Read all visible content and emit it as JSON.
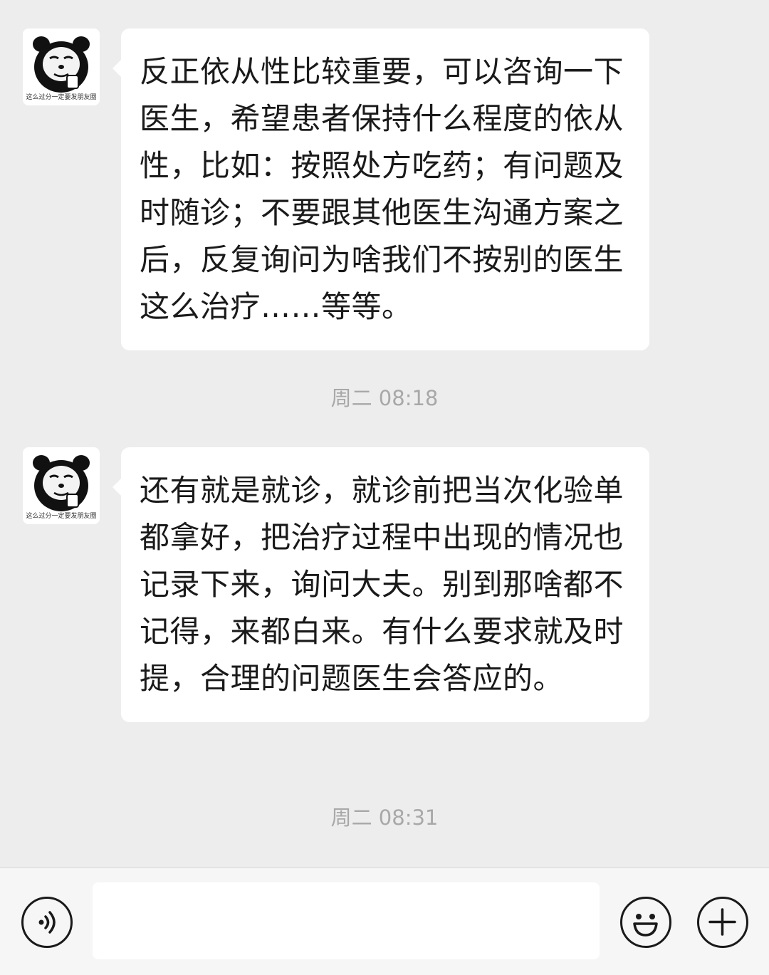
{
  "messages": [
    {
      "avatar_caption": "这么过分一定要发朋友圈",
      "text": "反正依从性比较重要，可以咨询一下医生，希望患者保持什么程度的依从性，比如：按照处方吃药；有问题及时随诊；不要跟其他医生沟通方案之后，反复询问为啥我们不按别的医生这么治疗……等等。"
    },
    {
      "avatar_caption": "这么过分一定要发朋友圈",
      "text": "还有就是就诊，就诊前把当次化验单都拿好，把治疗过程中出现的情况也记录下来，询问大夫。别到那啥都不记得，来都白来。有什么要求就及时提，合理的问题医生会答应的。"
    }
  ],
  "timestamps": [
    "周二 08:18",
    "周二 08:31"
  ],
  "input_bar": {
    "voice_icon": "voice-icon",
    "emoji_icon": "emoji-icon",
    "add_icon": "plus-icon",
    "input_value": ""
  },
  "colors": {
    "background": "#ededed",
    "bubble": "#ffffff",
    "timestamp": "#a8a8a8",
    "input_bar": "#f6f6f6"
  }
}
